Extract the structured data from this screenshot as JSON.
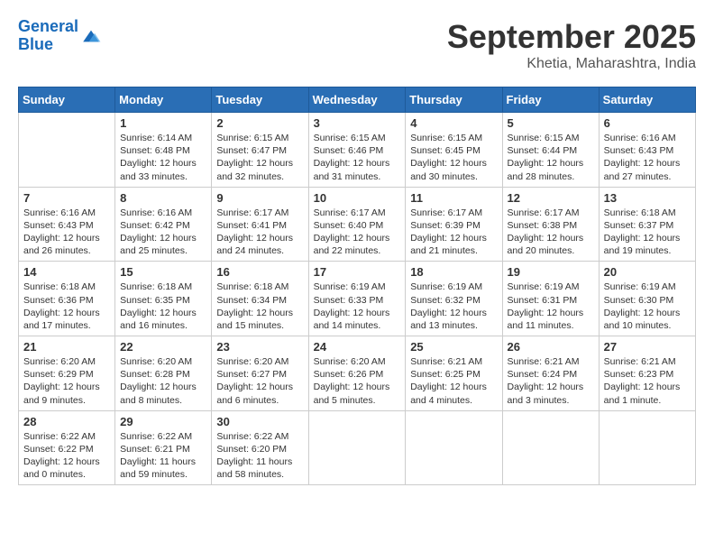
{
  "header": {
    "logo_line1": "General",
    "logo_line2": "Blue",
    "month": "September 2025",
    "location": "Khetia, Maharashtra, India"
  },
  "days_of_week": [
    "Sunday",
    "Monday",
    "Tuesday",
    "Wednesday",
    "Thursday",
    "Friday",
    "Saturday"
  ],
  "weeks": [
    [
      {
        "day": "",
        "text": ""
      },
      {
        "day": "1",
        "text": "Sunrise: 6:14 AM\nSunset: 6:48 PM\nDaylight: 12 hours\nand 33 minutes."
      },
      {
        "day": "2",
        "text": "Sunrise: 6:15 AM\nSunset: 6:47 PM\nDaylight: 12 hours\nand 32 minutes."
      },
      {
        "day": "3",
        "text": "Sunrise: 6:15 AM\nSunset: 6:46 PM\nDaylight: 12 hours\nand 31 minutes."
      },
      {
        "day": "4",
        "text": "Sunrise: 6:15 AM\nSunset: 6:45 PM\nDaylight: 12 hours\nand 30 minutes."
      },
      {
        "day": "5",
        "text": "Sunrise: 6:15 AM\nSunset: 6:44 PM\nDaylight: 12 hours\nand 28 minutes."
      },
      {
        "day": "6",
        "text": "Sunrise: 6:16 AM\nSunset: 6:43 PM\nDaylight: 12 hours\nand 27 minutes."
      }
    ],
    [
      {
        "day": "7",
        "text": "Sunrise: 6:16 AM\nSunset: 6:43 PM\nDaylight: 12 hours\nand 26 minutes."
      },
      {
        "day": "8",
        "text": "Sunrise: 6:16 AM\nSunset: 6:42 PM\nDaylight: 12 hours\nand 25 minutes."
      },
      {
        "day": "9",
        "text": "Sunrise: 6:17 AM\nSunset: 6:41 PM\nDaylight: 12 hours\nand 24 minutes."
      },
      {
        "day": "10",
        "text": "Sunrise: 6:17 AM\nSunset: 6:40 PM\nDaylight: 12 hours\nand 22 minutes."
      },
      {
        "day": "11",
        "text": "Sunrise: 6:17 AM\nSunset: 6:39 PM\nDaylight: 12 hours\nand 21 minutes."
      },
      {
        "day": "12",
        "text": "Sunrise: 6:17 AM\nSunset: 6:38 PM\nDaylight: 12 hours\nand 20 minutes."
      },
      {
        "day": "13",
        "text": "Sunrise: 6:18 AM\nSunset: 6:37 PM\nDaylight: 12 hours\nand 19 minutes."
      }
    ],
    [
      {
        "day": "14",
        "text": "Sunrise: 6:18 AM\nSunset: 6:36 PM\nDaylight: 12 hours\nand 17 minutes."
      },
      {
        "day": "15",
        "text": "Sunrise: 6:18 AM\nSunset: 6:35 PM\nDaylight: 12 hours\nand 16 minutes."
      },
      {
        "day": "16",
        "text": "Sunrise: 6:18 AM\nSunset: 6:34 PM\nDaylight: 12 hours\nand 15 minutes."
      },
      {
        "day": "17",
        "text": "Sunrise: 6:19 AM\nSunset: 6:33 PM\nDaylight: 12 hours\nand 14 minutes."
      },
      {
        "day": "18",
        "text": "Sunrise: 6:19 AM\nSunset: 6:32 PM\nDaylight: 12 hours\nand 13 minutes."
      },
      {
        "day": "19",
        "text": "Sunrise: 6:19 AM\nSunset: 6:31 PM\nDaylight: 12 hours\nand 11 minutes."
      },
      {
        "day": "20",
        "text": "Sunrise: 6:19 AM\nSunset: 6:30 PM\nDaylight: 12 hours\nand 10 minutes."
      }
    ],
    [
      {
        "day": "21",
        "text": "Sunrise: 6:20 AM\nSunset: 6:29 PM\nDaylight: 12 hours\nand 9 minutes."
      },
      {
        "day": "22",
        "text": "Sunrise: 6:20 AM\nSunset: 6:28 PM\nDaylight: 12 hours\nand 8 minutes."
      },
      {
        "day": "23",
        "text": "Sunrise: 6:20 AM\nSunset: 6:27 PM\nDaylight: 12 hours\nand 6 minutes."
      },
      {
        "day": "24",
        "text": "Sunrise: 6:20 AM\nSunset: 6:26 PM\nDaylight: 12 hours\nand 5 minutes."
      },
      {
        "day": "25",
        "text": "Sunrise: 6:21 AM\nSunset: 6:25 PM\nDaylight: 12 hours\nand 4 minutes."
      },
      {
        "day": "26",
        "text": "Sunrise: 6:21 AM\nSunset: 6:24 PM\nDaylight: 12 hours\nand 3 minutes."
      },
      {
        "day": "27",
        "text": "Sunrise: 6:21 AM\nSunset: 6:23 PM\nDaylight: 12 hours\nand 1 minute."
      }
    ],
    [
      {
        "day": "28",
        "text": "Sunrise: 6:22 AM\nSunset: 6:22 PM\nDaylight: 12 hours\nand 0 minutes."
      },
      {
        "day": "29",
        "text": "Sunrise: 6:22 AM\nSunset: 6:21 PM\nDaylight: 11 hours\nand 59 minutes."
      },
      {
        "day": "30",
        "text": "Sunrise: 6:22 AM\nSunset: 6:20 PM\nDaylight: 11 hours\nand 58 minutes."
      },
      {
        "day": "",
        "text": ""
      },
      {
        "day": "",
        "text": ""
      },
      {
        "day": "",
        "text": ""
      },
      {
        "day": "",
        "text": ""
      }
    ]
  ]
}
